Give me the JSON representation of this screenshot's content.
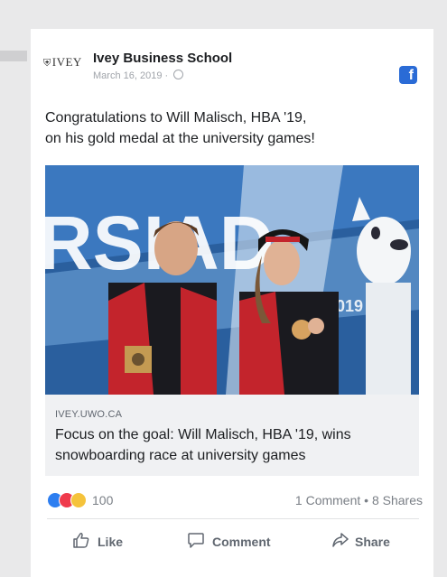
{
  "post": {
    "brand_logo": "IVEY",
    "page_name": "Ivey Business School",
    "date": "March 16, 2019",
    "separator": "·",
    "text_line1": "Congratulations to Will Malisch, HBA '19,",
    "text_line2": "on his gold medal at the university games!"
  },
  "photo": {
    "background_sign": "RSIAD",
    "year_sign": "2019"
  },
  "link": {
    "domain": "IVEY.UWO.CA",
    "title": "Focus on the goal: Will Malisch, HBA '19, wins snowboarding race at university games"
  },
  "stats": {
    "reaction_count": "100",
    "comments": "1 Comment",
    "dot": "•",
    "shares": "8 Shares"
  },
  "actions": {
    "like": "Like",
    "comment": "Comment",
    "share": "Share"
  },
  "icons": [
    "facebook-icon",
    "globe-icon",
    "like-reaction-icon",
    "love-reaction-icon",
    "haha-reaction-icon",
    "thumbs-up-icon",
    "comment-bubble-icon",
    "share-arrow-icon"
  ],
  "colors": {
    "facebook_blue": "#2a6bd6",
    "like_blue": "#2d7ef0",
    "love_red": "#ef3a4c",
    "haha_yellow": "#f5c33b"
  }
}
